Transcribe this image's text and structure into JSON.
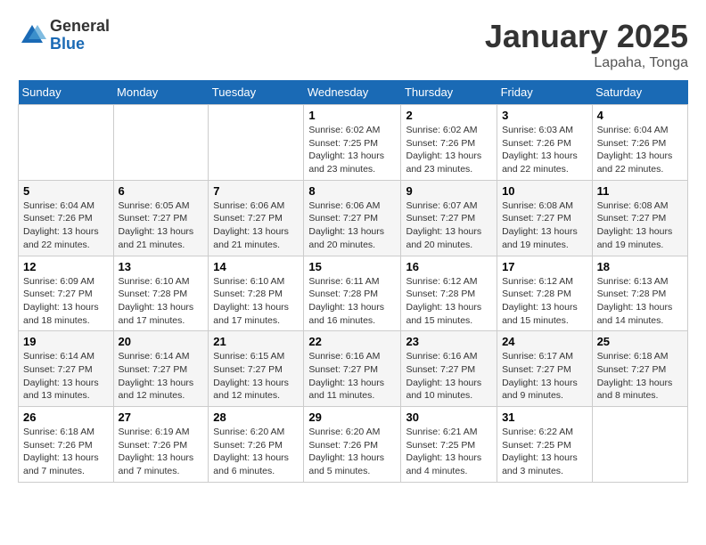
{
  "logo": {
    "general": "General",
    "blue": "Blue"
  },
  "title": "January 2025",
  "location": "Lapaha, Tonga",
  "days_of_week": [
    "Sunday",
    "Monday",
    "Tuesday",
    "Wednesday",
    "Thursday",
    "Friday",
    "Saturday"
  ],
  "weeks": [
    [
      {
        "day": "",
        "info": ""
      },
      {
        "day": "",
        "info": ""
      },
      {
        "day": "",
        "info": ""
      },
      {
        "day": "1",
        "info": "Sunrise: 6:02 AM\nSunset: 7:25 PM\nDaylight: 13 hours\nand 23 minutes."
      },
      {
        "day": "2",
        "info": "Sunrise: 6:02 AM\nSunset: 7:26 PM\nDaylight: 13 hours\nand 23 minutes."
      },
      {
        "day": "3",
        "info": "Sunrise: 6:03 AM\nSunset: 7:26 PM\nDaylight: 13 hours\nand 22 minutes."
      },
      {
        "day": "4",
        "info": "Sunrise: 6:04 AM\nSunset: 7:26 PM\nDaylight: 13 hours\nand 22 minutes."
      }
    ],
    [
      {
        "day": "5",
        "info": "Sunrise: 6:04 AM\nSunset: 7:26 PM\nDaylight: 13 hours\nand 22 minutes."
      },
      {
        "day": "6",
        "info": "Sunrise: 6:05 AM\nSunset: 7:27 PM\nDaylight: 13 hours\nand 21 minutes."
      },
      {
        "day": "7",
        "info": "Sunrise: 6:06 AM\nSunset: 7:27 PM\nDaylight: 13 hours\nand 21 minutes."
      },
      {
        "day": "8",
        "info": "Sunrise: 6:06 AM\nSunset: 7:27 PM\nDaylight: 13 hours\nand 20 minutes."
      },
      {
        "day": "9",
        "info": "Sunrise: 6:07 AM\nSunset: 7:27 PM\nDaylight: 13 hours\nand 20 minutes."
      },
      {
        "day": "10",
        "info": "Sunrise: 6:08 AM\nSunset: 7:27 PM\nDaylight: 13 hours\nand 19 minutes."
      },
      {
        "day": "11",
        "info": "Sunrise: 6:08 AM\nSunset: 7:27 PM\nDaylight: 13 hours\nand 19 minutes."
      }
    ],
    [
      {
        "day": "12",
        "info": "Sunrise: 6:09 AM\nSunset: 7:27 PM\nDaylight: 13 hours\nand 18 minutes."
      },
      {
        "day": "13",
        "info": "Sunrise: 6:10 AM\nSunset: 7:28 PM\nDaylight: 13 hours\nand 17 minutes."
      },
      {
        "day": "14",
        "info": "Sunrise: 6:10 AM\nSunset: 7:28 PM\nDaylight: 13 hours\nand 17 minutes."
      },
      {
        "day": "15",
        "info": "Sunrise: 6:11 AM\nSunset: 7:28 PM\nDaylight: 13 hours\nand 16 minutes."
      },
      {
        "day": "16",
        "info": "Sunrise: 6:12 AM\nSunset: 7:28 PM\nDaylight: 13 hours\nand 15 minutes."
      },
      {
        "day": "17",
        "info": "Sunrise: 6:12 AM\nSunset: 7:28 PM\nDaylight: 13 hours\nand 15 minutes."
      },
      {
        "day": "18",
        "info": "Sunrise: 6:13 AM\nSunset: 7:28 PM\nDaylight: 13 hours\nand 14 minutes."
      }
    ],
    [
      {
        "day": "19",
        "info": "Sunrise: 6:14 AM\nSunset: 7:27 PM\nDaylight: 13 hours\nand 13 minutes."
      },
      {
        "day": "20",
        "info": "Sunrise: 6:14 AM\nSunset: 7:27 PM\nDaylight: 13 hours\nand 12 minutes."
      },
      {
        "day": "21",
        "info": "Sunrise: 6:15 AM\nSunset: 7:27 PM\nDaylight: 13 hours\nand 12 minutes."
      },
      {
        "day": "22",
        "info": "Sunrise: 6:16 AM\nSunset: 7:27 PM\nDaylight: 13 hours\nand 11 minutes."
      },
      {
        "day": "23",
        "info": "Sunrise: 6:16 AM\nSunset: 7:27 PM\nDaylight: 13 hours\nand 10 minutes."
      },
      {
        "day": "24",
        "info": "Sunrise: 6:17 AM\nSunset: 7:27 PM\nDaylight: 13 hours\nand 9 minutes."
      },
      {
        "day": "25",
        "info": "Sunrise: 6:18 AM\nSunset: 7:27 PM\nDaylight: 13 hours\nand 8 minutes."
      }
    ],
    [
      {
        "day": "26",
        "info": "Sunrise: 6:18 AM\nSunset: 7:26 PM\nDaylight: 13 hours\nand 7 minutes."
      },
      {
        "day": "27",
        "info": "Sunrise: 6:19 AM\nSunset: 7:26 PM\nDaylight: 13 hours\nand 7 minutes."
      },
      {
        "day": "28",
        "info": "Sunrise: 6:20 AM\nSunset: 7:26 PM\nDaylight: 13 hours\nand 6 minutes."
      },
      {
        "day": "29",
        "info": "Sunrise: 6:20 AM\nSunset: 7:26 PM\nDaylight: 13 hours\nand 5 minutes."
      },
      {
        "day": "30",
        "info": "Sunrise: 6:21 AM\nSunset: 7:25 PM\nDaylight: 13 hours\nand 4 minutes."
      },
      {
        "day": "31",
        "info": "Sunrise: 6:22 AM\nSunset: 7:25 PM\nDaylight: 13 hours\nand 3 minutes."
      },
      {
        "day": "",
        "info": ""
      }
    ]
  ]
}
